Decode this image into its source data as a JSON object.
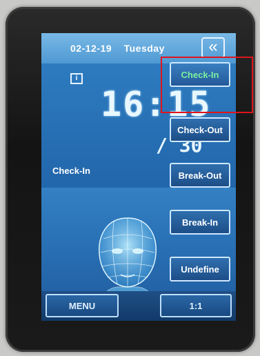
{
  "header": {
    "date": "02-12-19",
    "day": "Tuesday",
    "back_icon": "«"
  },
  "clock": {
    "hours_minutes": "16:",
    "minutes_partial": "15",
    "seconds": "/ 30"
  },
  "info_icon": "i",
  "status_text": "Check-In",
  "side_buttons": [
    {
      "label": "Check-In"
    },
    {
      "label": "Check-Out"
    },
    {
      "label": "Break-Out"
    },
    {
      "label": "Break-In"
    },
    {
      "label": "Undefine"
    }
  ],
  "bottom": {
    "menu_label": "MENU",
    "ratio_label": "1:1"
  },
  "colors": {
    "screen_blue": "#3d8fcf",
    "active_text": "#7cf0a0",
    "highlight": "#e0141b"
  }
}
